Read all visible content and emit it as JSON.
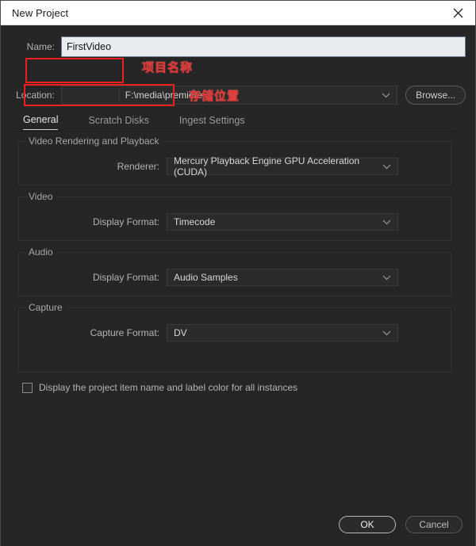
{
  "window": {
    "title": "New Project",
    "close_icon": "close-icon"
  },
  "name_field": {
    "label": "Name:",
    "value": "FirstVideo",
    "placeholder": ""
  },
  "location_field": {
    "label": "Location:",
    "value": "F:\\media\\premiere",
    "chevron_icon": "chevron-down-icon",
    "browse_label": "Browse..."
  },
  "annotations": [
    {
      "text": "项目名称"
    },
    {
      "text": "存储位置"
    }
  ],
  "tabs": [
    {
      "label": "General",
      "active": true
    },
    {
      "label": "Scratch Disks",
      "active": false
    },
    {
      "label": "Ingest Settings",
      "active": false
    }
  ],
  "groups": {
    "rendering": {
      "title": "Video Rendering and Playback",
      "field_label": "Renderer:",
      "field_value": "Mercury Playback Engine GPU Acceleration (CUDA)"
    },
    "video": {
      "title": "Video",
      "field_label": "Display Format:",
      "field_value": "Timecode"
    },
    "audio": {
      "title": "Audio",
      "field_label": "Display Format:",
      "field_value": "Audio Samples"
    },
    "capture": {
      "title": "Capture",
      "field_label": "Capture Format:",
      "field_value": "DV"
    }
  },
  "checkbox": {
    "label": "Display the project item name and label color for all instances",
    "checked": false
  },
  "footer": {
    "ok_label": "OK",
    "cancel_label": "Cancel"
  },
  "colors": {
    "background": "#262626",
    "titlebar": "#ffffff",
    "annotation_red": "#ef2020",
    "input_focus": "#e9ecef"
  }
}
